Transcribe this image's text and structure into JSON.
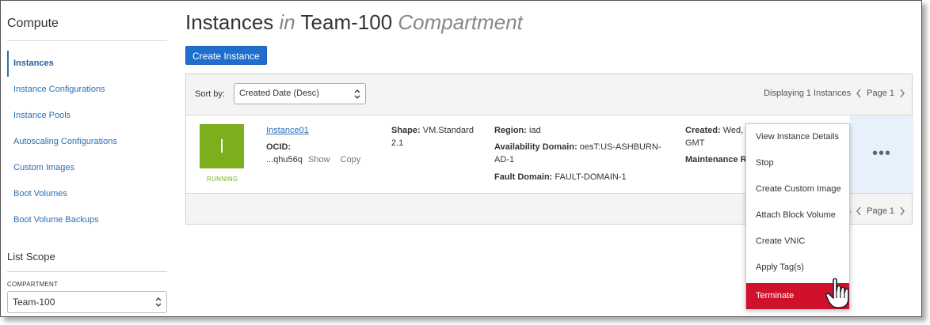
{
  "sidebar": {
    "title": "Compute",
    "items": [
      {
        "label": "Instances"
      },
      {
        "label": "Instance Configurations"
      },
      {
        "label": "Instance Pools"
      },
      {
        "label": "Autoscaling Configurations"
      },
      {
        "label": "Custom Images"
      },
      {
        "label": "Boot Volumes"
      },
      {
        "label": "Boot Volume Backups"
      }
    ],
    "scope_title": "List Scope",
    "compartment_label": "COMPARTMENT",
    "compartment_value": "Team-100"
  },
  "header": {
    "title_1": "Instances",
    "title_in": "in",
    "title_2": "Team-100",
    "title_compartment": "Compartment",
    "create_button": "Create Instance"
  },
  "list": {
    "sort_label": "Sort by:",
    "sort_value": "Created Date (Desc)",
    "pager_text": "Displaying 1 Instances",
    "page_text": "Page 1",
    "bottom_pager_fragment": "s",
    "bottom_page_text": "Page 1"
  },
  "instance": {
    "name": "Instance01",
    "status": "RUNNING",
    "ocid_label": "OCID:",
    "ocid_value": "...qhu56q",
    "show_label": "Show",
    "copy_label": "Copy",
    "shape_label": "Shape:",
    "shape_value": "VM.Standard",
    "shape_value_2": "2.1",
    "region_label": "Region:",
    "region_value": "iad",
    "ad_label": "Availability Domain:",
    "ad_value": "oesT:US-ASHBURN-",
    "ad_value_2": "AD-1",
    "fd_label": "Fault Domain:",
    "fd_value": "FAULT-DOMAIN-1",
    "created_label": "Created:",
    "created_value": "Wed, 0",
    "created_value_2": "GMT",
    "maintenance_label": "Maintenance R"
  },
  "menu": {
    "items": [
      {
        "label": "View Instance Details"
      },
      {
        "label": "Stop"
      },
      {
        "label": "Create Custom Image"
      },
      {
        "label": "Attach Block Volume"
      },
      {
        "label": "Create VNIC"
      },
      {
        "label": "Apply Tag(s)"
      },
      {
        "label": "Terminate"
      }
    ]
  },
  "colors": {
    "accent": "#1f6fcf",
    "link": "#2b6fb4",
    "running": "#7cae1d",
    "danger": "#d0112b"
  }
}
